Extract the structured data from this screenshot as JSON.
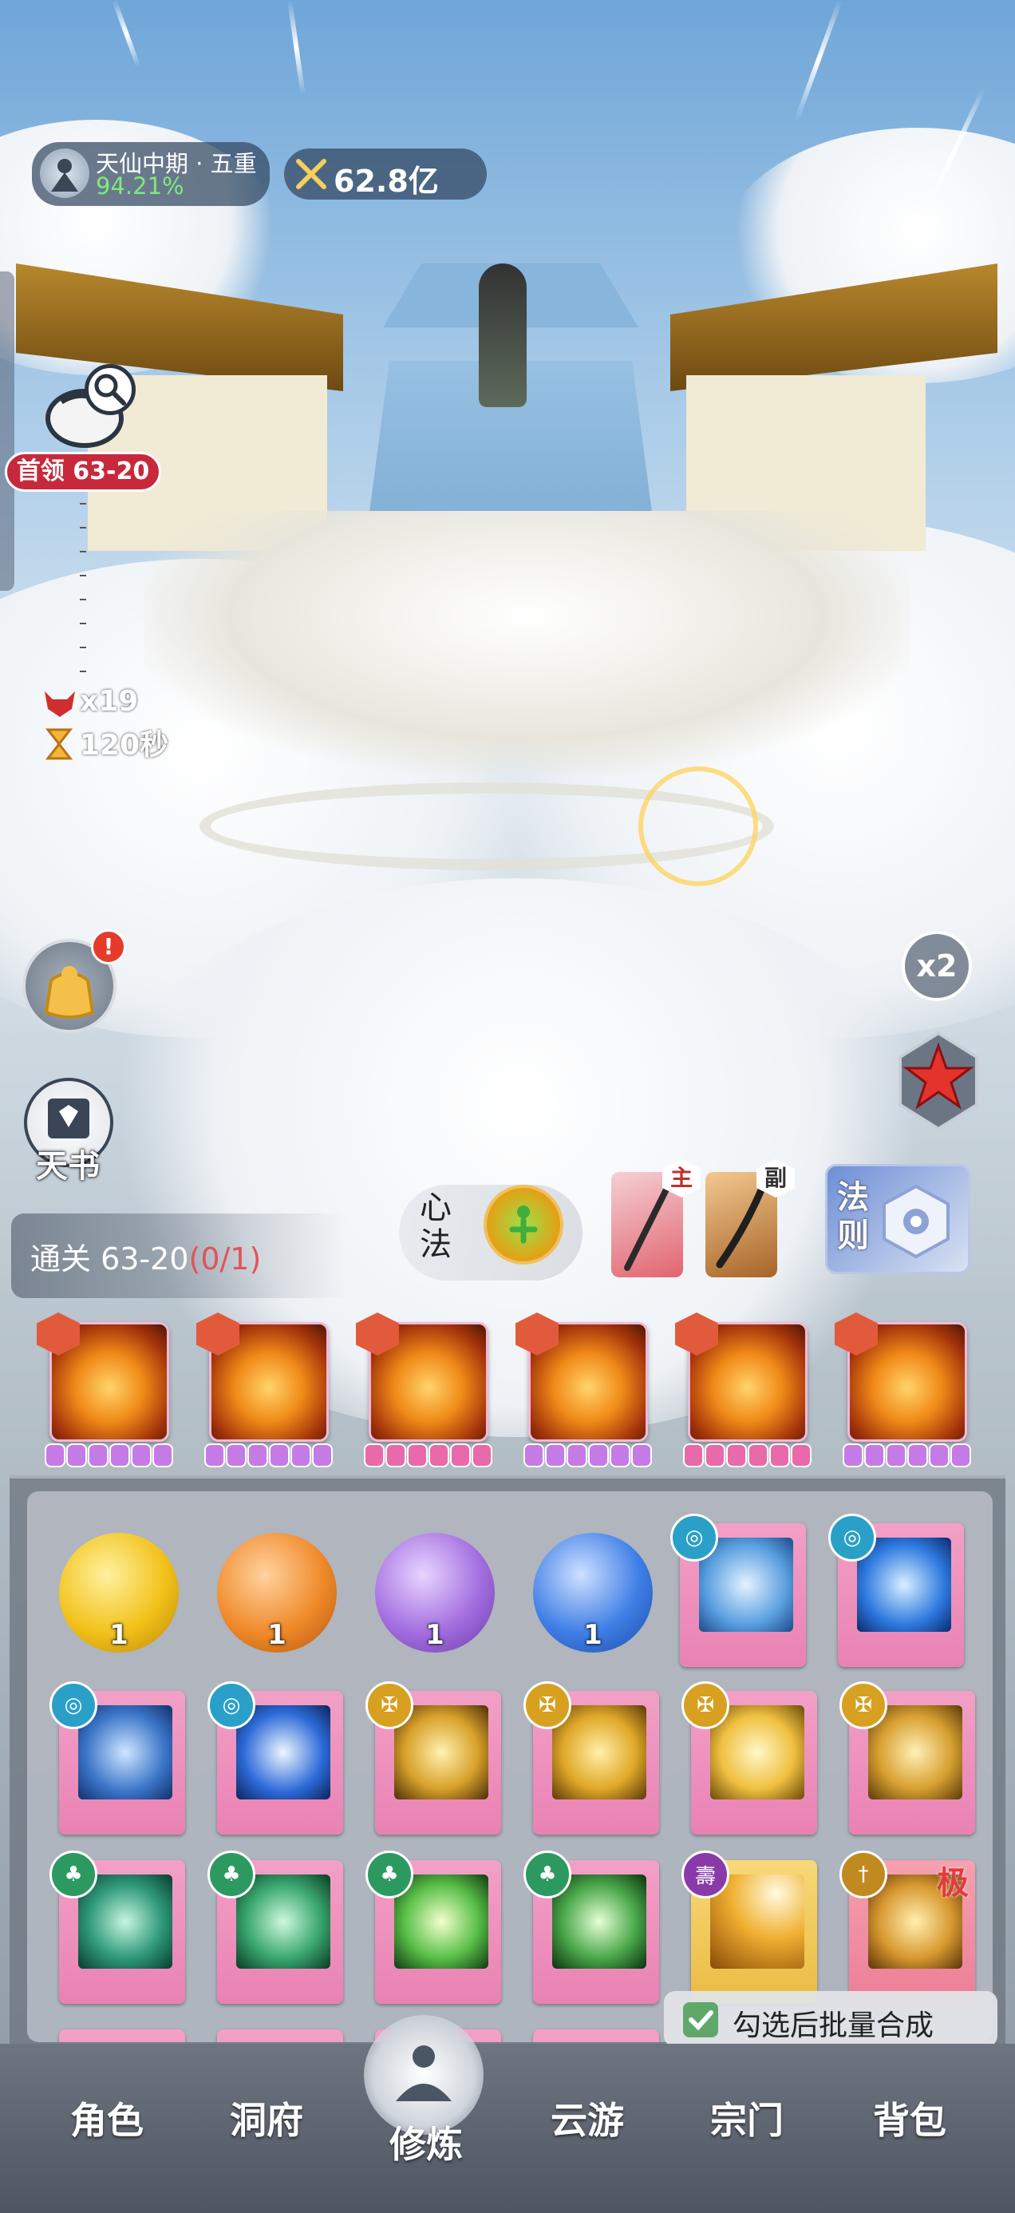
{
  "hud": {
    "realm": "天仙中期 · 五重",
    "realm_progress": "94.21%",
    "power": "62.8亿"
  },
  "boss": {
    "label": "首领 63-20",
    "kills": "x19",
    "timer": "120秒"
  },
  "left_buttons": {
    "tianshu_label": "天书",
    "alert_mark": "!"
  },
  "right_buttons": {
    "speed_label": "x2"
  },
  "stage": {
    "prefix": "通关 63-20",
    "progress": "(0/1)"
  },
  "xinfa": {
    "label": "心法"
  },
  "weapons": {
    "main_tag": "主",
    "sub_tag": "副"
  },
  "faze": {
    "label": "法则"
  },
  "equipped_skills": [
    {
      "icon": "fire-lotus-icon"
    },
    {
      "icon": "fire-phoenix-icon"
    },
    {
      "icon": "fire-beast-icon"
    },
    {
      "icon": "fire-pagoda-icon"
    },
    {
      "icon": "fire-buddha-icon"
    },
    {
      "icon": "fire-spirit-icon"
    }
  ],
  "inventory": {
    "orbs": [
      {
        "count": "1",
        "color": "#f2c21a"
      },
      {
        "count": "1",
        "color": "#f08a2a"
      },
      {
        "count": "1",
        "color": "#a36ee0"
      },
      {
        "count": "1",
        "color": "#3f7fe6"
      }
    ],
    "rare_mark": "极",
    "batch_label": "勾选后批量合成"
  },
  "nav": {
    "items": [
      "角色",
      "洞府",
      "修炼",
      "云游",
      "宗门",
      "背包"
    ],
    "active": "修炼"
  },
  "colors": {
    "stage_progress": "#e0545a",
    "realm_progress": "#7dea7d",
    "boss_tag": "#c8283c"
  }
}
